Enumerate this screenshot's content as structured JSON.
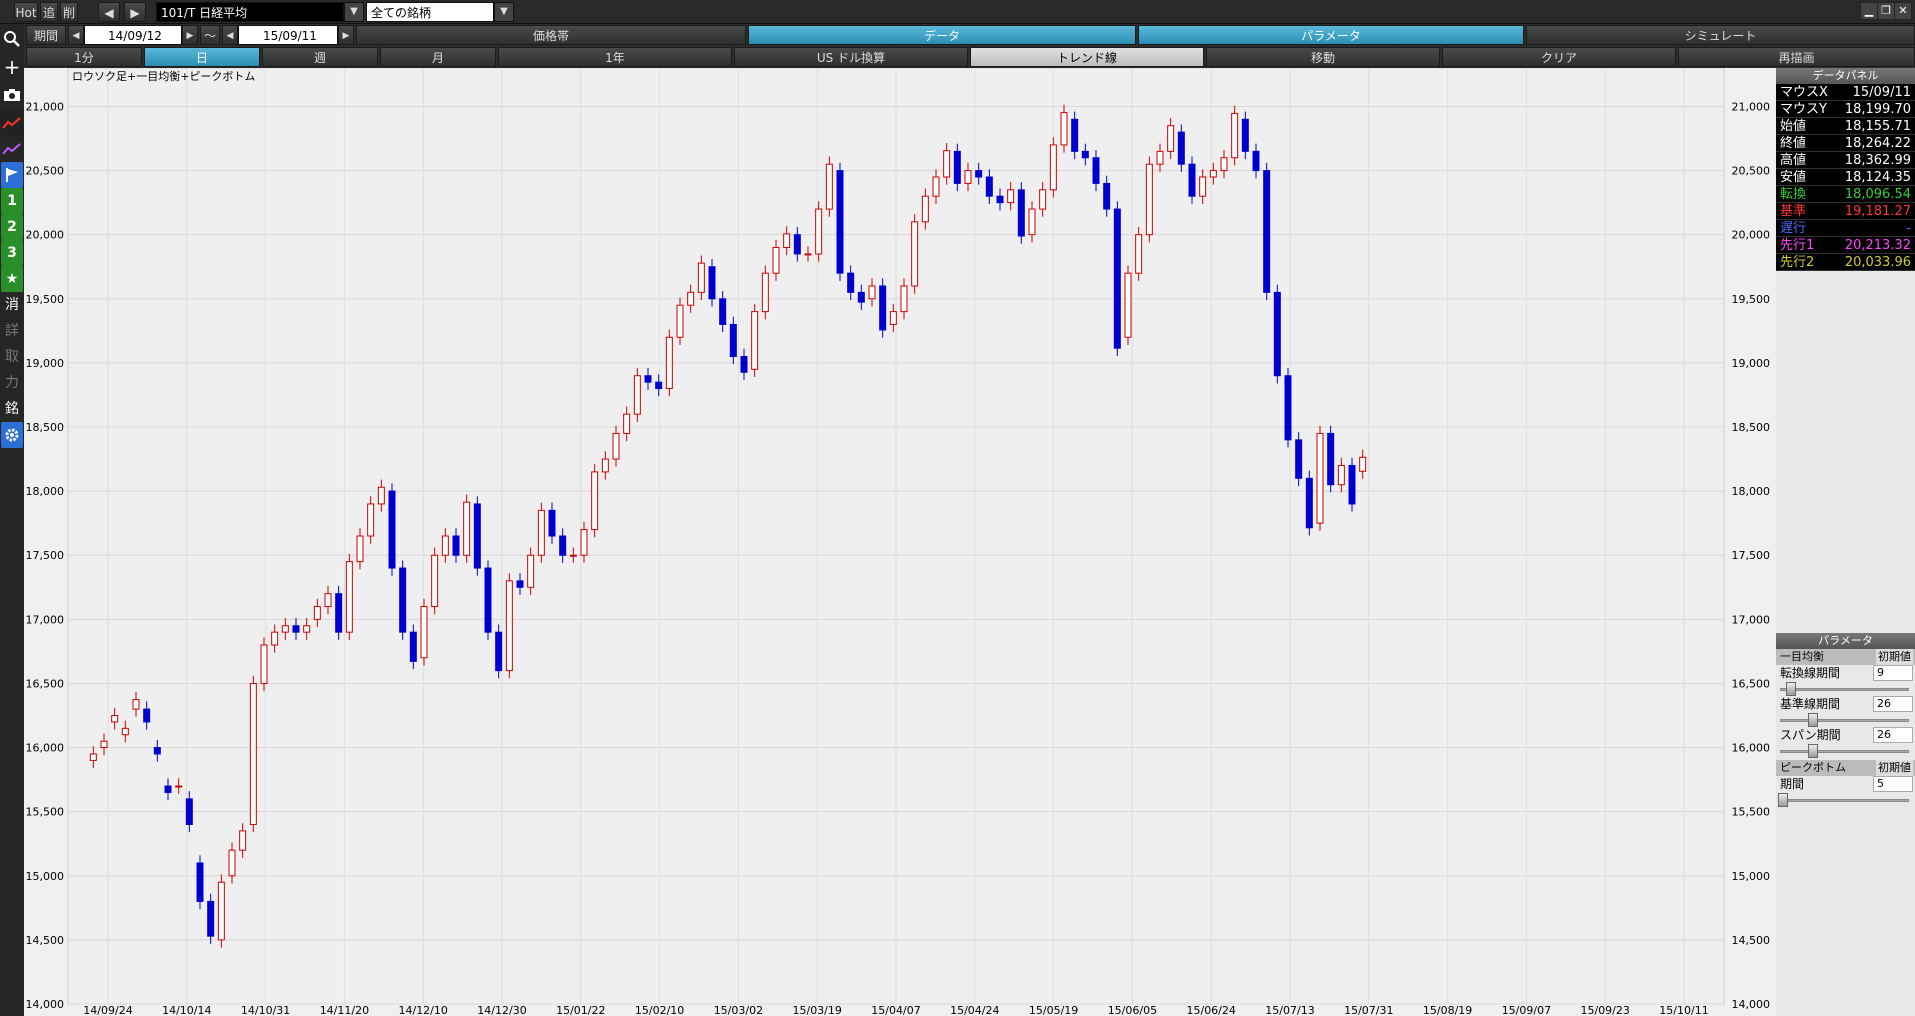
{
  "toolbar": {
    "hot": "Hot",
    "add": "追",
    "del": "削",
    "prev": "◀",
    "next": "▶",
    "symbol": "101/T 日経平均",
    "universe": "全ての銘柄",
    "period_label": "期間",
    "date_from": "14/09/12",
    "tilde": "～",
    "date_to": "15/09/11",
    "price_band": "価格帯",
    "data_tab": "データ",
    "param_tab": "パラメータ",
    "simulate": "シミュレート",
    "minimize": "▁",
    "restore": "❐",
    "close": "✕"
  },
  "row3": {
    "b1": "1分",
    "b2": "日",
    "b3": "週",
    "b4": "月",
    "b5": "1年",
    "b6": "US ドル換算",
    "b7": "トレンド線",
    "b8": "移動",
    "b9": "クリア",
    "b10": "再描画"
  },
  "leftbar": [
    "search-icon",
    "crosshair-icon",
    "camera-icon",
    "chart-red-icon",
    "chart-purple-icon",
    "flag-icon",
    "1",
    "2",
    "3",
    "★",
    "消",
    "詳",
    "取",
    "力",
    "銘",
    "gear-icon"
  ],
  "data_panel": {
    "title": "データパネル",
    "rows": [
      {
        "k": "マウスX",
        "v": "15/09/11",
        "kc": "#fff",
        "vc": "#fff"
      },
      {
        "k": "マウスY",
        "v": "18,199.70",
        "kc": "#fff",
        "vc": "#fff"
      },
      {
        "k": "始値",
        "v": "18,155.71",
        "kc": "#fff",
        "vc": "#fff"
      },
      {
        "k": "終値",
        "v": "18,264.22",
        "kc": "#fff",
        "vc": "#fff"
      },
      {
        "k": "高値",
        "v": "18,362.99",
        "kc": "#fff",
        "vc": "#fff"
      },
      {
        "k": "安値",
        "v": "18,124.35",
        "kc": "#fff",
        "vc": "#fff"
      },
      {
        "k": "転換",
        "v": "18,096.54",
        "kc": "#33cc33",
        "vc": "#33cc33"
      },
      {
        "k": "基準",
        "v": "19,181.27",
        "kc": "#ff3333",
        "vc": "#ff3333"
      },
      {
        "k": "遅行",
        "v": "-",
        "kc": "#4a6cff",
        "vc": "#4a6cff"
      },
      {
        "k": "先行1",
        "v": "20,213.32",
        "kc": "#ff44ff",
        "vc": "#ff44ff"
      },
      {
        "k": "先行2",
        "v": "20,033.96",
        "kc": "#cccc33",
        "vc": "#cccc33"
      }
    ]
  },
  "param_panel": {
    "title": "パラメータ",
    "ichimoku": "一目均衡",
    "init": "初期値",
    "tenkan_label": "転換線期間",
    "tenkan": "9",
    "kijun_label": "基準線期間",
    "kijun": "26",
    "span_label": "スパン期間",
    "span": "26",
    "peak": "ピークボトム",
    "period_label": "期間",
    "period": "5"
  },
  "chart_data": {
    "type": "candlestick",
    "title": "ロウソク足+一目均衡+ピークボトム",
    "ylim": [
      14000,
      21300
    ],
    "y_ticks": [
      "21,000",
      "20,500",
      "20,000",
      "19,500",
      "19,000",
      "18,500",
      "18,000",
      "17,500",
      "17,000",
      "16,500",
      "16,000",
      "15,500",
      "15,000",
      "14,500",
      "14,000"
    ],
    "x_ticks": [
      "14/09/24",
      "14/10/14",
      "14/10/31",
      "14/11/20",
      "14/12/10",
      "14/12/30",
      "15/01/22",
      "15/02/10",
      "15/03/02",
      "15/03/19",
      "15/04/07",
      "15/04/24",
      "15/05/19",
      "15/06/05",
      "15/06/24",
      "15/07/13",
      "15/07/31",
      "15/08/19",
      "15/09/07",
      "15/09/23",
      "15/10/11"
    ],
    "close": [
      15950,
      16050,
      16250,
      16150,
      16374,
      16200,
      15950,
      15650,
      15700,
      15400,
      14800,
      14529,
      14950,
      15200,
      15350,
      16500,
      16800,
      16900,
      16950,
      16900,
      16950,
      17100,
      17200,
      16900,
      17450,
      17650,
      17900,
      18030,
      17400,
      16900,
      16672,
      17100,
      17500,
      17650,
      17500,
      17914,
      17400,
      16900,
      16600,
      17300,
      17250,
      17500,
      17850,
      17650,
      17500,
      17500,
      17700,
      18150,
      18250,
      18450,
      18600,
      18900,
      18850,
      18800,
      19200,
      19450,
      19550,
      19778,
      19500,
      19300,
      19050,
      18927,
      19400,
      19700,
      19900,
      20006,
      19850,
      19850,
      20200,
      20550,
      19700,
      19550,
      19474,
      19600,
      19257,
      19400,
      19600,
      20100,
      20300,
      20450,
      20655,
      20400,
      20500,
      20450,
      20300,
      20250,
      20350,
      19990,
      20200,
      20350,
      20700,
      20952,
      20650,
      20600,
      20400,
      20200,
      19115,
      19700,
      20000,
      20550,
      20650,
      20850,
      20550,
      20300,
      20450,
      20500,
      20600,
      20946,
      20650,
      20500,
      19550,
      18900,
      18400,
      18100,
      17714,
      18450,
      18050,
      18200,
      17900,
      18264
    ],
    "open": [
      15900,
      16000,
      16200,
      16100,
      16300,
      16300,
      16000,
      15700,
      15700,
      15600,
      15100,
      14800,
      14500,
      15000,
      15200,
      15400,
      16500,
      16800,
      16900,
      16950,
      16900,
      17000,
      17100,
      17200,
      16900,
      17450,
      17650,
      17900,
      18000,
      17400,
      16900,
      16700,
      17100,
      17500,
      17650,
      17500,
      17900,
      17400,
      16900,
      16600,
      17300,
      17250,
      17500,
      17850,
      17650,
      17500,
      17500,
      17700,
      18150,
      18250,
      18450,
      18600,
      18900,
      18850,
      18800,
      19200,
      19450,
      19550,
      19750,
      19500,
      19300,
      19050,
      18950,
      19400,
      19700,
      19900,
      20000,
      19850,
      19850,
      20200,
      20500,
      19700,
      19550,
      19500,
      19600,
      19300,
      19400,
      19600,
      20100,
      20300,
      20450,
      20650,
      20400,
      20500,
      20450,
      20300,
      20250,
      20350,
      20000,
      20200,
      20350,
      20700,
      20900,
      20650,
      20600,
      20400,
      20200,
      19200,
      19700,
      20000,
      20550,
      20650,
      20800,
      20550,
      20300,
      20450,
      20500,
      20600,
      20900,
      20650,
      20500,
      19550,
      18900,
      18400,
      18100,
      17750,
      18450,
      18050,
      18200,
      18155
    ]
  }
}
